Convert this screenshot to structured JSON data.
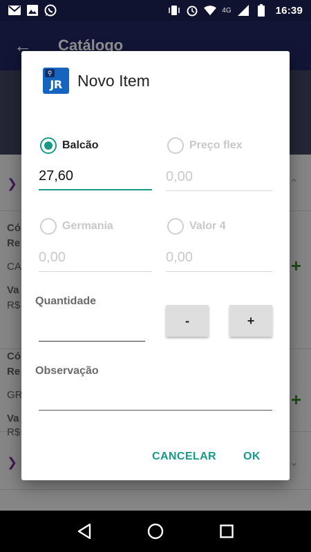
{
  "status_bar": {
    "left_icons": [
      "gmail-icon",
      "image-icon",
      "whatsapp-icon"
    ],
    "network": "4G",
    "time": "16:39"
  },
  "background": {
    "app_title": "Catálogo",
    "list_fragments": [
      {
        "t1": "Có",
        "t2": "Re",
        "t3": "CA",
        "t4": "Va",
        "t5": "R$"
      },
      {
        "t1": "Có",
        "t2": "Re",
        "t3": "GR",
        "t4": "Va",
        "t5": "R$"
      }
    ]
  },
  "dialog": {
    "title": "Novo Item",
    "logo_text": "JR",
    "price_options": [
      {
        "label": "Balcão",
        "selected": true,
        "value": "27,60",
        "placeholder": ""
      },
      {
        "label": "Preço flex",
        "selected": false,
        "value": "",
        "placeholder": "0,00"
      },
      {
        "label": "Germania",
        "selected": false,
        "value": "",
        "placeholder": "0,00"
      },
      {
        "label": "Valor 4",
        "selected": false,
        "value": "",
        "placeholder": "0,00"
      }
    ],
    "quantity_label": "Quantidade",
    "minus_label": "-",
    "plus_label": "+",
    "observation_label": "Observação",
    "cancel_label": "CANCELAR",
    "ok_label": "OK"
  },
  "colors": {
    "accent": "#169a86",
    "app_bar": "#1d2357",
    "status_bar": "#0f1330"
  }
}
